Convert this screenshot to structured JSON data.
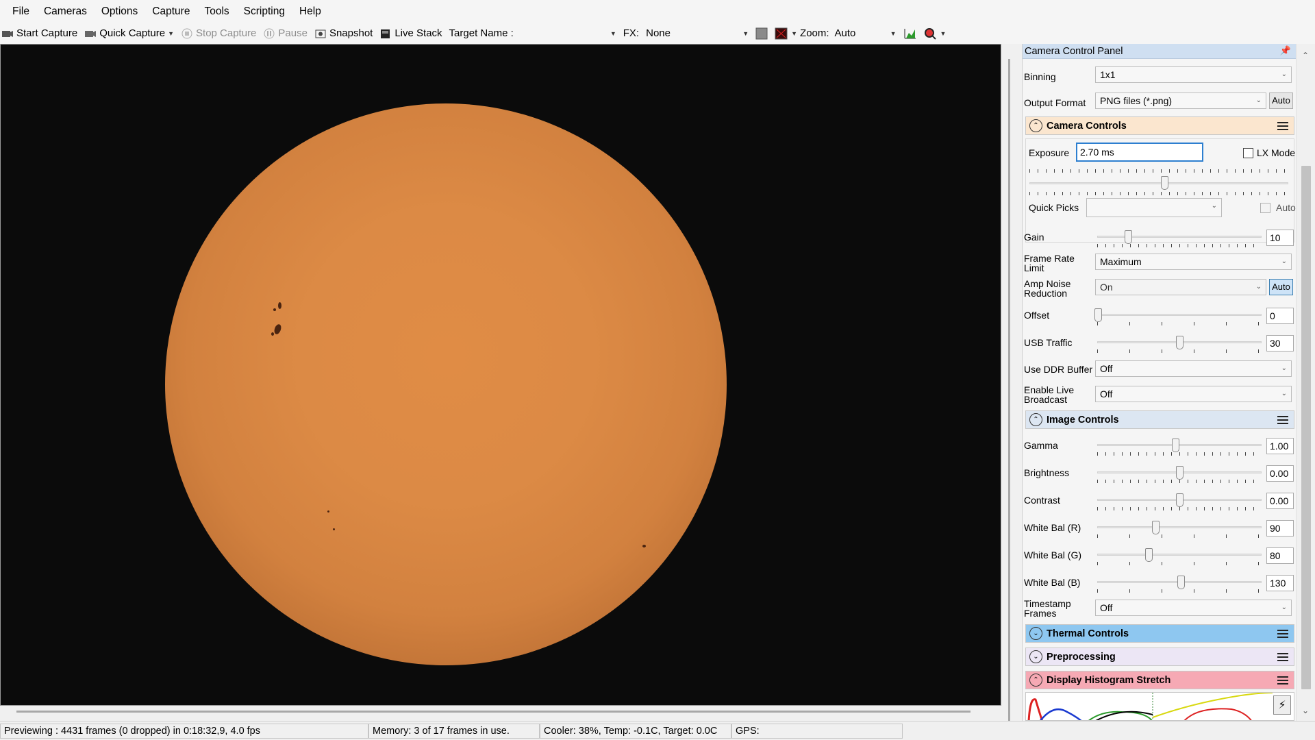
{
  "menu": [
    "File",
    "Cameras",
    "Options",
    "Capture",
    "Tools",
    "Scripting",
    "Help"
  ],
  "toolbar": {
    "start_capture": "Start Capture",
    "quick_capture": "Quick Capture",
    "stop_capture": "Stop Capture",
    "pause": "Pause",
    "snapshot": "Snapshot",
    "live_stack": "Live Stack",
    "target_name_label": "Target Name :",
    "target_name_value": "",
    "fx_label": "FX:",
    "fx_value": "None",
    "zoom_label": "Zoom:",
    "zoom_value": "Auto"
  },
  "panel": {
    "title": "Camera Control Panel",
    "binning_label": "Binning",
    "binning_value": "1x1",
    "output_format_label": "Output Format",
    "output_format_value": "PNG files (*.png)",
    "auto_label": "Auto",
    "camera_controls": {
      "title": "Camera Controls",
      "exposure_label": "Exposure",
      "exposure_value": "2.70 ms",
      "lx_mode_label": "LX Mode",
      "lx_mode_checked": false,
      "quick_picks_label": "Quick Picks",
      "quick_picks_value": "",
      "quick_picks_auto": "Auto",
      "gain_label": "Gain",
      "gain_value": "10",
      "frame_rate_label": "Frame Rate Limit",
      "frame_rate_value": "Maximum",
      "amp_noise_label": "Amp Noise Reduction",
      "amp_noise_value": "On",
      "offset_label": "Offset",
      "offset_value": "0",
      "usb_traffic_label": "USB Traffic",
      "usb_traffic_value": "30",
      "ddr_label": "Use DDR Buffer",
      "ddr_value": "Off",
      "broadcast_label": "Enable Live Broadcast",
      "broadcast_value": "Off"
    },
    "image_controls": {
      "title": "Image Controls",
      "gamma_label": "Gamma",
      "gamma_value": "1.00",
      "brightness_label": "Brightness",
      "brightness_value": "0.00",
      "contrast_label": "Contrast",
      "contrast_value": "0.00",
      "wb_r_label": "White Bal (R)",
      "wb_r_value": "90",
      "wb_g_label": "White Bal (G)",
      "wb_g_value": "80",
      "wb_b_label": "White Bal (B)",
      "wb_b_value": "130",
      "timestamp_label": "Timestamp Frames",
      "timestamp_value": "Off"
    },
    "collapsed_sections": [
      "Thermal Controls",
      "Preprocessing",
      "Display Histogram Stretch"
    ]
  },
  "status": {
    "preview": "Previewing : 4431 frames (0 dropped) in 0:18:32,9, 4.0 fps",
    "memory": "Memory: 3 of 17 frames in use.",
    "cooler": "Cooler: 38%, Temp: -0.1C, Target: 0.0C",
    "gps": "GPS:"
  },
  "colors": {
    "panel_title_bg": "#cfdff1",
    "camera_controls_bg": "#fbe6cf",
    "image_controls_bg": "#dce6f2",
    "thermal_controls_bg": "#8ec7f0",
    "preprocessing_bg": "#ece6f5",
    "histogram_bg": "#f6a9b4",
    "sun": "#dc8a45"
  }
}
